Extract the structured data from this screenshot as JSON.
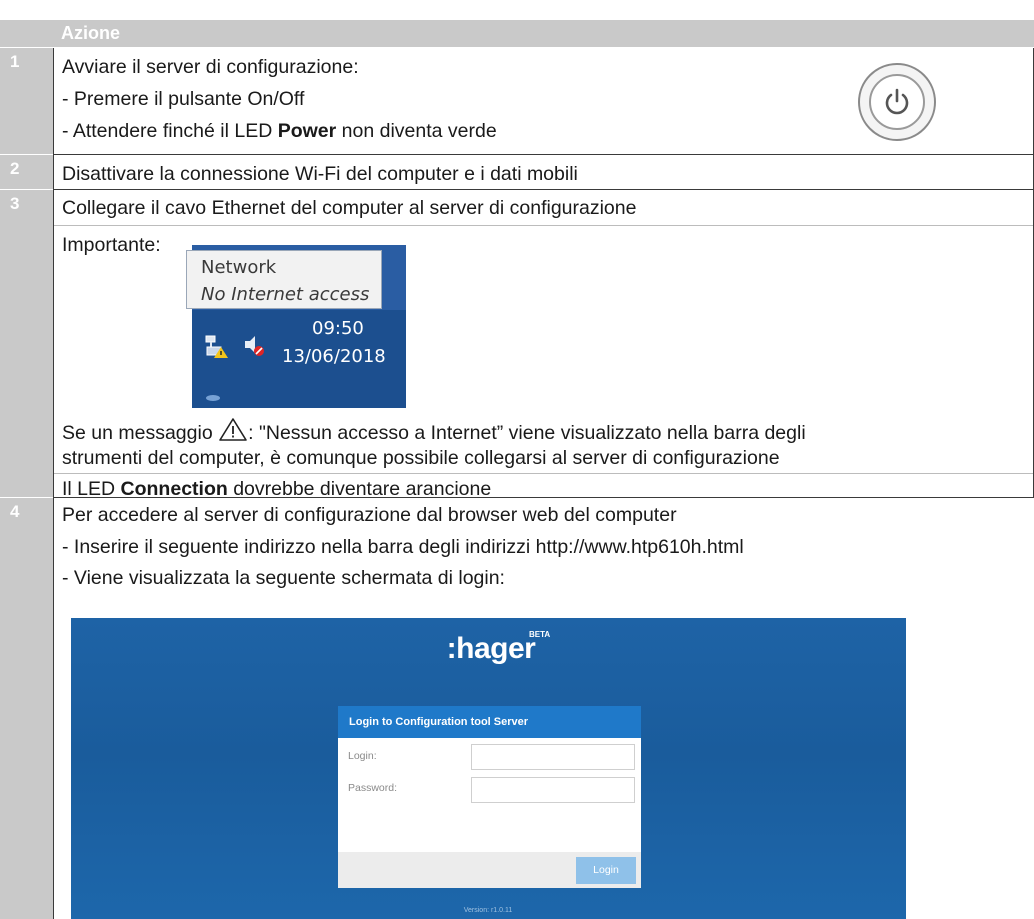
{
  "table": {
    "header": "Azione",
    "step_numbers": [
      "1",
      "2",
      "3",
      "4"
    ]
  },
  "step1": {
    "line1": "Avviare il server di configurazione:",
    "line2": "- Premere il pulsante On/Off",
    "line3_pre": "- Attendere finché il LED ",
    "line3_bold": "Power",
    "line3_post": " non diventa verde"
  },
  "step2": {
    "line1": "Disattivare la connessione Wi-Fi del computer e i dati mobili"
  },
  "step3": {
    "line1": "Collegare il cavo Ethernet del computer al server di configurazione",
    "important": "Importante:",
    "tray": {
      "title": "Network",
      "subtitle": "No Internet access",
      "time": "09:50",
      "date": "13/06/2018"
    },
    "msg_pre": "Se un messaggio ",
    "msg_post": ": \"Nessun accesso a Internet” viene visualizzato nella barra degli",
    "msg_line2": "strumenti del computer, è comunque possibile collegarsi al server di configurazione",
    "led_pre": "Il LED ",
    "led_bold": "Connection",
    "led_post": " dovrebbe diventare arancione"
  },
  "step4": {
    "line1": "Per accedere al server di configurazione dal browser web del computer",
    "line2": "- Inserire il seguente indirizzo nella barra degli indirizzi http://www.htp610h.html",
    "line3": "- Viene visualizzata la seguente schermata di login:",
    "login": {
      "logo": ":hager",
      "beta": "BETA",
      "card_title": "Login to Configuration tool Server",
      "login_label": "Login:",
      "password_label": "Password:",
      "login_value": "",
      "password_value": "",
      "button": "Login",
      "version": "Version: r1.0.11"
    }
  },
  "colors": {
    "header_bg": "#c9c9c9",
    "hager_blue": "#1e63a6",
    "login_header": "#1f79c9",
    "login_button": "#8fc1e9"
  }
}
